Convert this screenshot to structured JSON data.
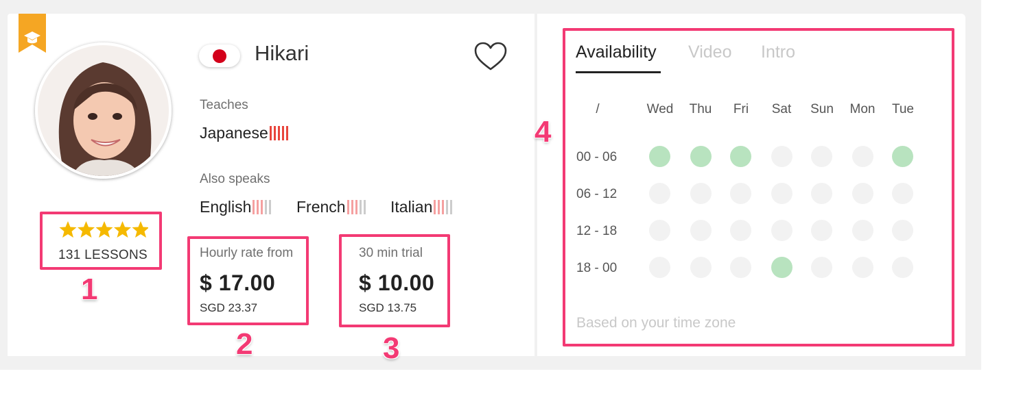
{
  "tutor": {
    "name": "Hikari",
    "rating_stars": 5,
    "lessons_label": "131 LESSONS",
    "flag_icon": "japan-flag-icon"
  },
  "teaches": {
    "label": "Teaches",
    "languages": [
      {
        "name": "Japanese",
        "level_bars": 5,
        "bar_colors": [
          "#e8453c",
          "#e8453c",
          "#e8453c",
          "#e8453c",
          "#e8453c"
        ]
      }
    ]
  },
  "also_speaks": {
    "label": "Also speaks",
    "languages": [
      {
        "name": "English",
        "level_bars": 3
      },
      {
        "name": "French",
        "level_bars": 3
      },
      {
        "name": "Italian",
        "level_bars": 3
      }
    ]
  },
  "pricing": {
    "hourly": {
      "label": "Hourly rate from",
      "price": "$ 17.00",
      "local": "SGD 23.37"
    },
    "trial": {
      "label": "30 min trial",
      "price": "$ 10.00",
      "local": "SGD 13.75"
    }
  },
  "annotations": [
    "1",
    "2",
    "3",
    "4"
  ],
  "availability": {
    "tabs": [
      "Availability",
      "Video",
      "Intro"
    ],
    "active_tab": "Availability",
    "corner_label": "/",
    "days": [
      "Wed",
      "Thu",
      "Fri",
      "Sat",
      "Sun",
      "Mon",
      "Tue"
    ],
    "slots": [
      {
        "label": "00 - 06",
        "available": [
          true,
          true,
          true,
          false,
          false,
          false,
          true
        ]
      },
      {
        "label": "06 - 12",
        "available": [
          false,
          false,
          false,
          false,
          false,
          false,
          false
        ]
      },
      {
        "label": "12 - 18",
        "available": [
          false,
          false,
          false,
          false,
          false,
          false,
          false
        ]
      },
      {
        "label": "18 - 00",
        "available": [
          false,
          false,
          false,
          true,
          false,
          false,
          false
        ]
      }
    ],
    "footer_note": "Based on your time zone"
  },
  "colors": {
    "annotation": "#f33a74",
    "available": "#b8e3bf",
    "unavailable": "#f2f2f2",
    "star": "#f5b900",
    "bookmark": "#f5a623",
    "level_strong": "#e8453c",
    "level_light": "#f5a0a0",
    "level_empty": "#cccccc"
  }
}
